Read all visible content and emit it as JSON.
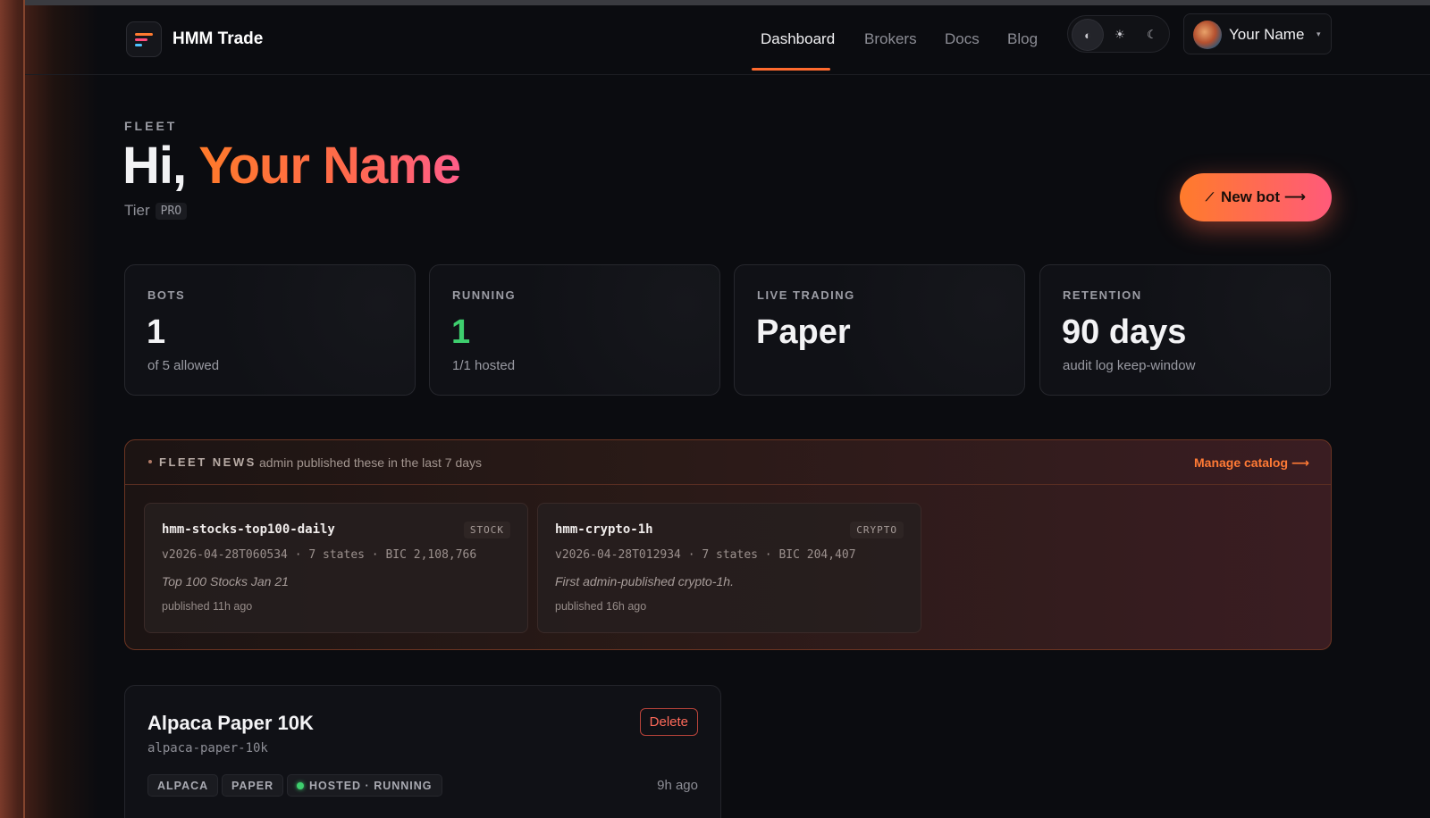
{
  "brand": {
    "name": "HMM Trade",
    "logo_icon": "menu-lines-logo-icon"
  },
  "nav": [
    {
      "label": "Dashboard",
      "active": true
    },
    {
      "label": "Brokers",
      "active": false
    },
    {
      "label": "Docs",
      "active": false
    },
    {
      "label": "Blog",
      "active": false
    }
  ],
  "theme": {
    "options": [
      {
        "icon": "contrast-icon",
        "glyph": "◐",
        "active": true
      },
      {
        "icon": "sun-icon",
        "glyph": "☀",
        "active": false
      },
      {
        "icon": "moon-icon",
        "glyph": "☾",
        "active": false
      }
    ]
  },
  "user": {
    "name": "Your Name",
    "caret": "▾"
  },
  "hero": {
    "eyebrow": "FLEET",
    "greeting_prefix": "Hi, ",
    "greeting_name": "Your Name",
    "tier_label": "Tier",
    "tier_value": "PRO",
    "new_bot_label": "New bot ⟶",
    "new_bot_icon": "⟋"
  },
  "stats": [
    {
      "label": "BOTS",
      "value": "1",
      "sub": "of 5 allowed",
      "accent": "#f3f3f5"
    },
    {
      "label": "RUNNING",
      "value": "1",
      "sub": "1/1 hosted",
      "accent": "#3ecf6e"
    },
    {
      "label": "LIVE TRADING",
      "value": "Paper",
      "sub": "",
      "accent": "#f3f3f5"
    },
    {
      "label": "RETENTION",
      "value": "90 days",
      "sub": "audit log keep-window",
      "accent": "#f3f3f5"
    }
  ],
  "news": {
    "title": "FLEET NEWS",
    "description": "admin published these in the last 7 days",
    "manage_label": "Manage catalog ⟶",
    "items": [
      {
        "name": "hmm-stocks-top100-daily",
        "badge": "STOCK",
        "meta": "v2026-04-28T060534 · 7 states · BIC 2,108,766",
        "note": "Top 100 Stocks Jan 21",
        "time": "published 11h ago"
      },
      {
        "name": "hmm-crypto-1h",
        "badge": "CRYPTO",
        "meta": "v2026-04-28T012934 · 7 states · BIC 204,407",
        "note": "First admin-published crypto-1h.",
        "time": "published 16h ago"
      }
    ]
  },
  "bot": {
    "name": "Alpaca Paper 10K",
    "slug": "alpaca-paper-10k",
    "delete_label": "Delete",
    "tags": [
      "ALPACA",
      "PAPER",
      "HOSTED · RUNNING"
    ],
    "time": "9h ago",
    "status_color": "#3ecf6e"
  }
}
